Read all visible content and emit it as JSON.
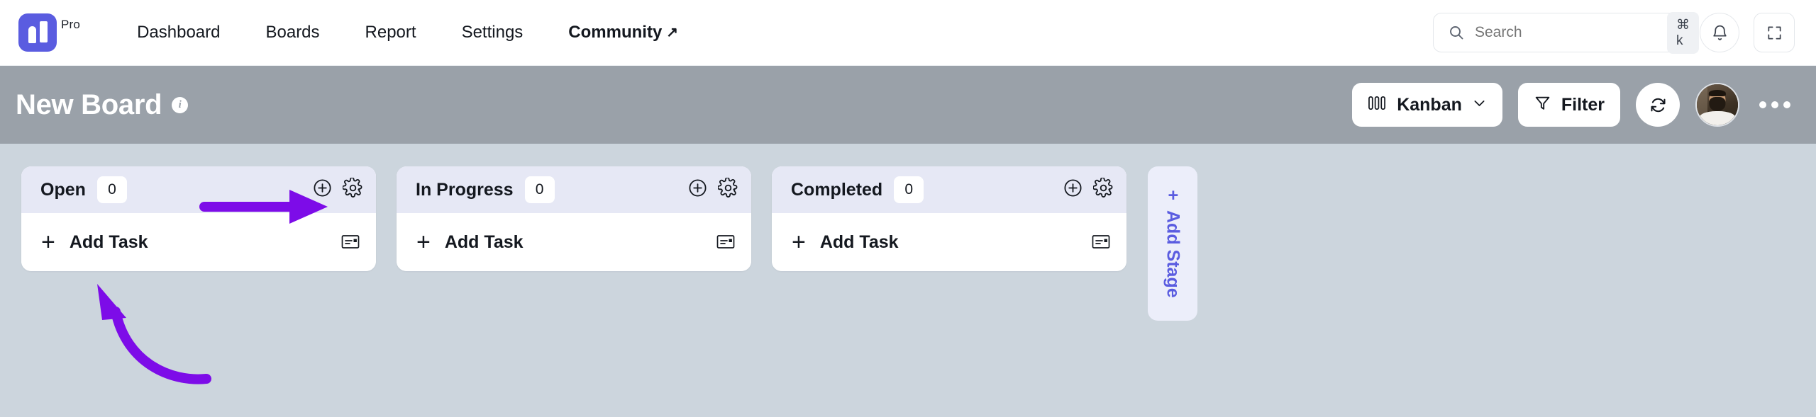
{
  "topnav": {
    "logo_name": "app-logo",
    "plan_label": "Pro",
    "links": [
      {
        "label": "Dashboard",
        "icon": ""
      },
      {
        "label": "Boards",
        "icon": ""
      },
      {
        "label": "Report",
        "icon": ""
      },
      {
        "label": "Settings",
        "icon": ""
      },
      {
        "label": "Community",
        "icon": "↗"
      }
    ],
    "search": {
      "placeholder": "Search",
      "value": "",
      "shortcut": "⌘ k",
      "icon": "search-icon"
    },
    "notification_icon": "bell-icon",
    "fullscreen_icon": "fullscreen-icon"
  },
  "board_header": {
    "title": "New Board",
    "info_icon": "info-icon",
    "info_glyph": "i",
    "view_label": "Kanban",
    "view_icon": "kanban-columns-icon",
    "view_chevron": "chevron-down-icon",
    "filter_label": "Filter",
    "filter_icon": "funnel-icon",
    "refresh_icon": "refresh-icon",
    "avatar_name": "user-avatar",
    "more_icon": "more-horizontal-icon",
    "bar_color": "#9aa1a9"
  },
  "board": {
    "background_color": "#ccd5dd",
    "column_header_color": "#e6e8f5",
    "accent_color": "#5a5ce0",
    "columns": [
      {
        "title": "Open",
        "count": "0",
        "add_icon": "circle-plus-icon",
        "settings_icon": "gear-icon",
        "add_task_label": "Add Task",
        "add_task_plus": "+",
        "template_icon": "card-template-icon"
      },
      {
        "title": "In Progress",
        "count": "0",
        "add_icon": "circle-plus-icon",
        "settings_icon": "gear-icon",
        "add_task_label": "Add Task",
        "add_task_plus": "+",
        "template_icon": "card-template-icon"
      },
      {
        "title": "Completed",
        "count": "0",
        "add_icon": "circle-plus-icon",
        "settings_icon": "gear-icon",
        "add_task_label": "Add Task",
        "add_task_plus": "+",
        "template_icon": "card-template-icon"
      }
    ],
    "add_stage": {
      "label": "Add Stage",
      "plus": "+"
    }
  },
  "annotations": {
    "color": "#7d0ce8",
    "arrow_straight_name": "annotation-arrow-to-add-card",
    "arrow_curved_name": "annotation-arrow-to-add-task"
  }
}
